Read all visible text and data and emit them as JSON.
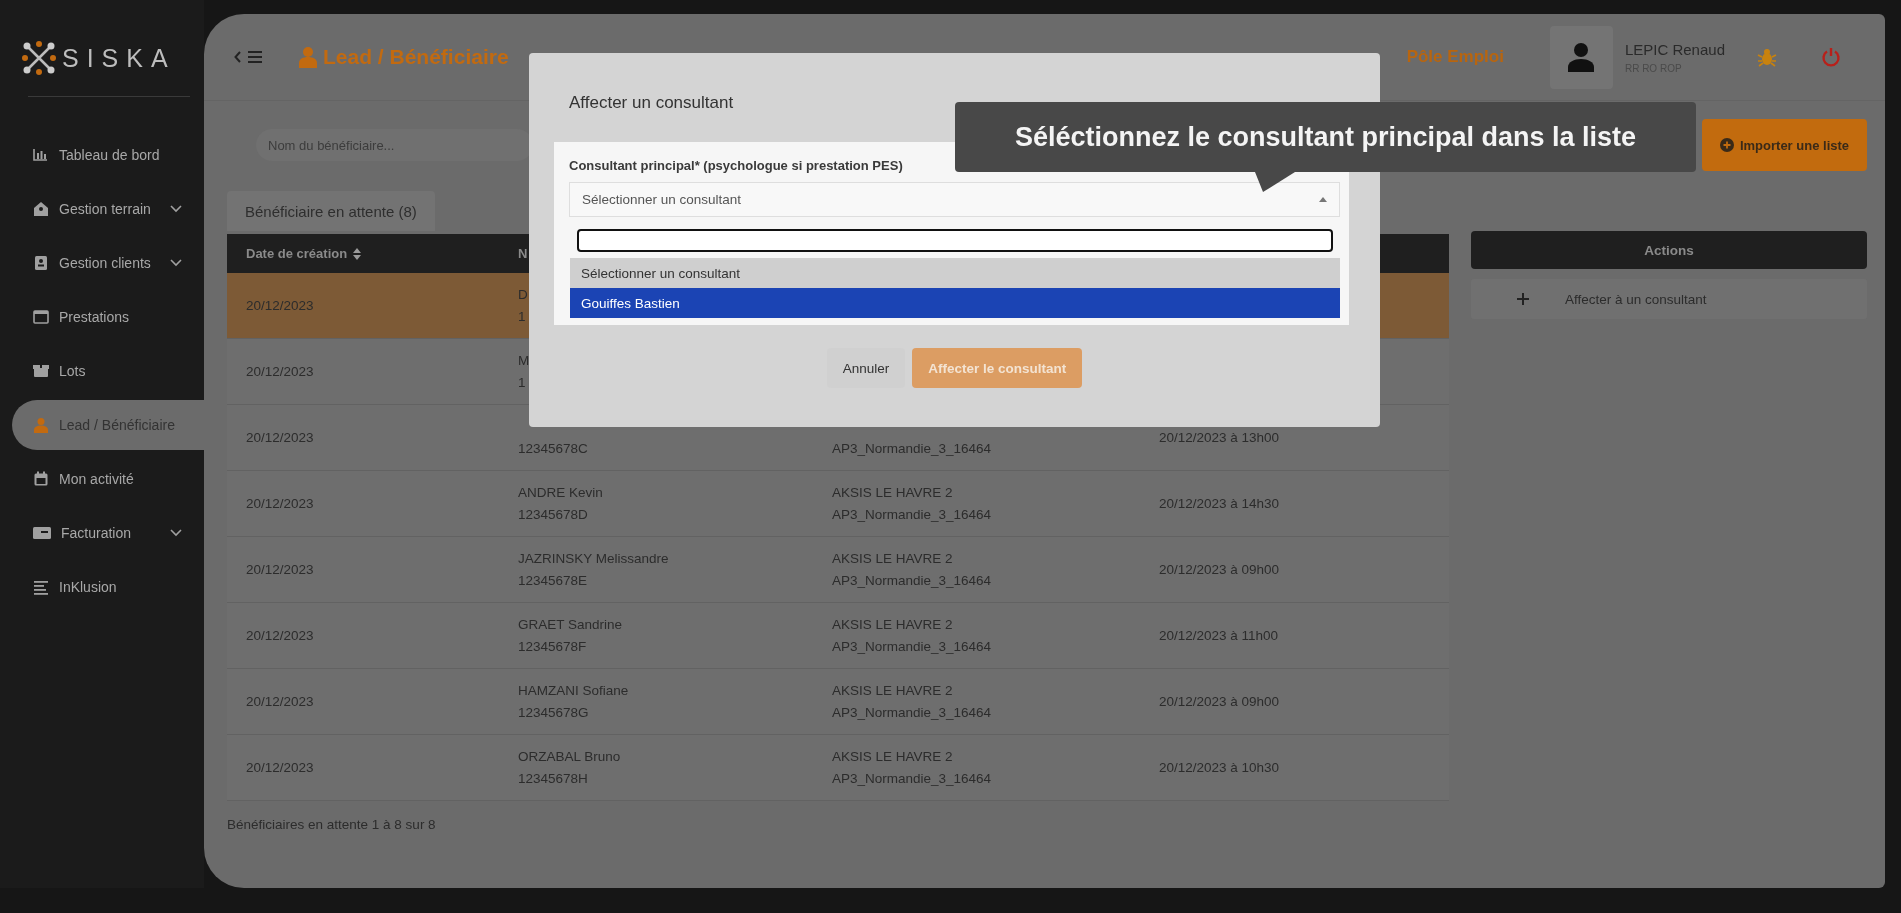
{
  "sidebar": {
    "logo": "SISKA",
    "items": [
      {
        "label": "Tableau de bord",
        "selected": false,
        "expandable": false
      },
      {
        "label": "Gestion terrain",
        "selected": false,
        "expandable": true
      },
      {
        "label": "Gestion clients",
        "selected": false,
        "expandable": true
      },
      {
        "label": "Prestations",
        "selected": false,
        "expandable": false
      },
      {
        "label": "Lots",
        "selected": false,
        "expandable": false
      },
      {
        "label": "Lead / Bénéficiaire",
        "selected": true,
        "expandable": false
      },
      {
        "label": "Mon activité",
        "selected": false,
        "expandable": false
      },
      {
        "label": "Facturation",
        "selected": false,
        "expandable": true
      },
      {
        "label": "InKlusion",
        "selected": false,
        "expandable": false
      }
    ]
  },
  "header": {
    "title": "Lead / Bénéficiaire",
    "subtitle": "Pôle Emploi",
    "user": {
      "name": "LEPIC Renaud",
      "role": "RR RO ROP"
    }
  },
  "search": {
    "placeholder": "Nom du bénéficiaire..."
  },
  "import_button": "Importer une liste",
  "tabs": [
    {
      "label": "Bénéficiaire en attente (8)",
      "selected": true
    }
  ],
  "table": {
    "columns": [
      {
        "label": "Date de création",
        "sortable": true
      },
      {
        "label": "N"
      }
    ],
    "rows": [
      {
        "selected": true,
        "cells": [
          [
            "20/12/2023"
          ],
          [
            "D",
            "1"
          ]
        ]
      },
      {
        "selected": false,
        "cells": [
          [
            "20/12/2023"
          ],
          [
            "M",
            "1"
          ]
        ]
      },
      {
        "selected": false,
        "cells": [
          [
            "20/12/2023"
          ],
          [
            null,
            "12345678C"
          ],
          [
            null,
            "AP3_Normandie_3_16464"
          ],
          [
            "20/12/2023 à 13h00"
          ]
        ]
      },
      {
        "selected": false,
        "cells": [
          [
            "20/12/2023"
          ],
          [
            "ANDRE Kevin",
            "12345678D"
          ],
          [
            "AKSIS LE HAVRE 2",
            "AP3_Normandie_3_16464"
          ],
          [
            "20/12/2023 à 14h30"
          ]
        ]
      },
      {
        "selected": false,
        "cells": [
          [
            "20/12/2023"
          ],
          [
            "JAZRINSKY Melissandre",
            "12345678E"
          ],
          [
            "AKSIS LE HAVRE 2",
            "AP3_Normandie_3_16464"
          ],
          [
            "20/12/2023 à 09h00"
          ]
        ]
      },
      {
        "selected": false,
        "cells": [
          [
            "20/12/2023"
          ],
          [
            "GRAET Sandrine",
            "12345678F"
          ],
          [
            "AKSIS LE HAVRE 2",
            "AP3_Normandie_3_16464"
          ],
          [
            "20/12/2023 à 11h00"
          ]
        ]
      },
      {
        "selected": false,
        "cells": [
          [
            "20/12/2023"
          ],
          [
            "HAMZANI Sofiane",
            "12345678G"
          ],
          [
            "AKSIS LE HAVRE 2",
            "AP3_Normandie_3_16464"
          ],
          [
            "20/12/2023 à 09h00"
          ]
        ]
      },
      {
        "selected": false,
        "cells": [
          [
            "20/12/2023"
          ],
          [
            "ORZABAL Bruno",
            "12345678H"
          ],
          [
            "AKSIS LE HAVRE 2",
            "AP3_Normandie_3_16464"
          ],
          [
            "20/12/2023 à 10h30"
          ]
        ]
      }
    ]
  },
  "actions": {
    "title": "Actions",
    "items": [
      "Affecter à un consultant"
    ]
  },
  "footer": "Bénéficiaires en attente 1 à 8 sur 8",
  "modal": {
    "title": "Affecter un consultant",
    "field": {
      "label": "Consultant principal* (psychologue si prestation PES)",
      "placeholder": "Sélectionner un consultant",
      "expanded": true
    },
    "options": [
      {
        "label": "Sélectionner un consultant",
        "selected": false
      },
      {
        "label": "Gouiffes Bastien",
        "selected": true
      }
    ],
    "buttons": [
      {
        "label": "Annuler",
        "kind": "secondary"
      },
      {
        "label": "Affecter le consultant",
        "kind": "primary"
      }
    ]
  },
  "tooltip": "Séléctionnez le consultant principal dans la liste"
}
